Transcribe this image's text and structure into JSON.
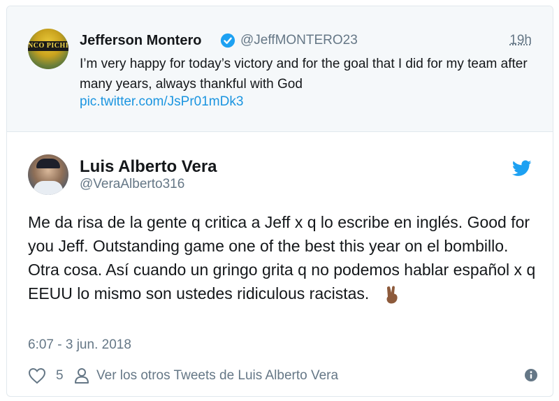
{
  "quoted_tweet": {
    "avatar_text": "NCO PICHI",
    "name": "Jefferson Montero",
    "handle": "@JeffMONTERO23",
    "time": "19h",
    "text": "I’m very happy for today’s victory and for the goal that I did for my team after many years, always thankful with God",
    "link": "pic.twitter.com/JsPr01mDk3"
  },
  "main_tweet": {
    "name": "Luis Alberto Vera",
    "handle": "@VeraAlberto316",
    "text": "Me da risa de la gente q critica a Jeff x q lo escribe en inglés. Good for you Jeff. Outstanding game one of the best this year on el bombillo. Otra cosa. Así cuando un gringo grita q no podemos hablar español x q EEUU lo mismo son ustedes ridiculous racistas.",
    "date": "6:07 - 3 jun. 2018",
    "likes": "5",
    "others_link": "Ver los otros Tweets de Luis Alberto Vera"
  },
  "colors": {
    "text": "#14171a",
    "secondary": "#657786",
    "link": "#1b95e0",
    "quoted_bg": "#f5f8fa",
    "border": "#e1e8ed"
  },
  "icons": [
    "verified-badge-icon",
    "twitter-bird-icon",
    "heart-icon",
    "person-icon",
    "info-icon",
    "victory-hand-emoji"
  ]
}
